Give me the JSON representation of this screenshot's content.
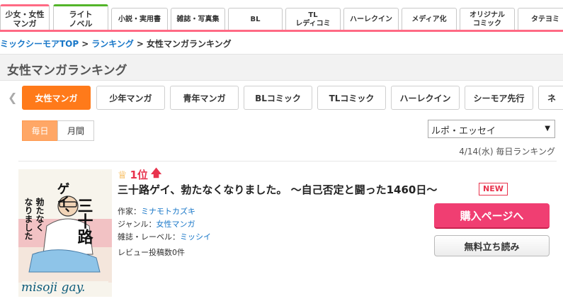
{
  "top_tabs": [
    {
      "label": "少女・女性\nマンガ"
    },
    {
      "label": "ライト\nノベル"
    },
    {
      "label": "小説・実用書"
    },
    {
      "label": "雑誌・写真集"
    },
    {
      "label": "BL"
    },
    {
      "label": "TL\nレディコミ"
    },
    {
      "label": "ハーレクイン"
    },
    {
      "label": "メディア化"
    },
    {
      "label": "オリジナル\nコミック"
    },
    {
      "label": "タテヨミ"
    }
  ],
  "breadcrumb": {
    "home": "ミックシーモアTOP",
    "ranking": "ランキング",
    "current": "女性マンガランキング",
    "separator": ">"
  },
  "page_title": "女性マンガランキング",
  "genre_tabs": [
    "女性マンガ",
    "少年マンガ",
    "青年マンガ",
    "BLコミック",
    "TLコミック",
    "ハーレクイン",
    "シーモア先行",
    "ネ"
  ],
  "period": {
    "daily": "毎日",
    "monthly": "月間"
  },
  "category_select": {
    "value": "ルポ・エッセイ"
  },
  "ranking_date": "4/14(水) 毎日ランキング",
  "item": {
    "rank": "1位",
    "title": "三十路ゲイ、勃たなくなりました。 ～自己否定と闘った1460日～",
    "badge": "NEW",
    "author_label": "作家：",
    "author": "ミナモトカズキ",
    "genre_label": "ジャンル：",
    "genre": "女性マンガ",
    "label_label": "雑誌・レーベル：",
    "label": "ミッシイ",
    "reviews": "レビュー投稿数0件",
    "buy_button": "購入ページへ",
    "free_button": "無料立ち読み",
    "cover": {
      "title_vertical": "三十路ゲイ、勃たなくなりました",
      "author_vertical": "ミナモトカズキ",
      "logo": "misoji gay."
    }
  },
  "colors": {
    "accent_pink": "#ff6a84",
    "active_orange": "#ff7a1a",
    "buy_pink": "#f03e72",
    "link_blue": "#1877c8"
  }
}
